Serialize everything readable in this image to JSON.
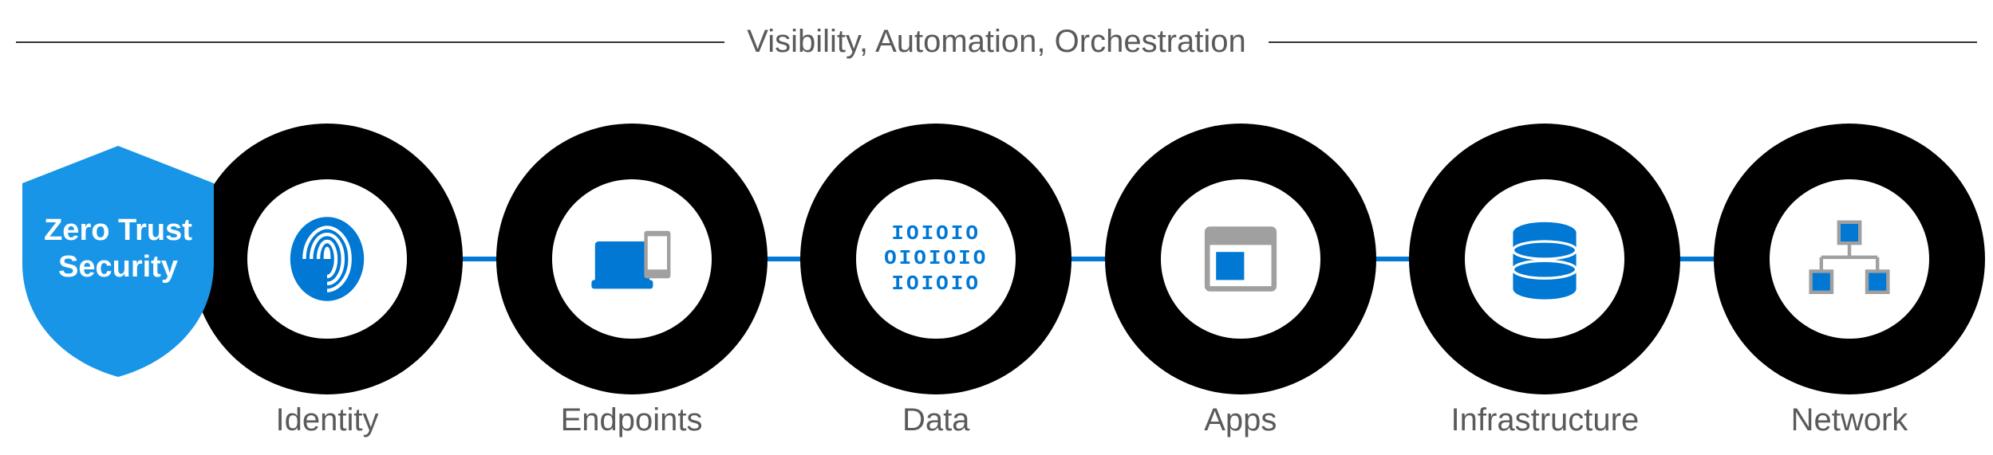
{
  "title": "Visibility, Automation, Orchestration",
  "shield": {
    "label": "Zero Trust\nSecurity"
  },
  "pillars": [
    {
      "id": "identity",
      "label": "Identity",
      "icon": "fingerprint-icon"
    },
    {
      "id": "endpoints",
      "label": "Endpoints",
      "icon": "devices-icon"
    },
    {
      "id": "data",
      "label": "Data",
      "icon": "binary-icon",
      "binary": [
        "IOIOIO",
        "OIOIOIO",
        "IOIOIO"
      ]
    },
    {
      "id": "apps",
      "label": "Apps",
      "icon": "app-window-icon"
    },
    {
      "id": "infrastructure",
      "label": "Infrastructure",
      "icon": "database-icon"
    },
    {
      "id": "network",
      "label": "Network",
      "icon": "network-icon"
    }
  ],
  "colors": {
    "primary": "#0078d4",
    "ring": "#000000",
    "gray": "#a0a0a0",
    "text": "#5a5a5a"
  }
}
